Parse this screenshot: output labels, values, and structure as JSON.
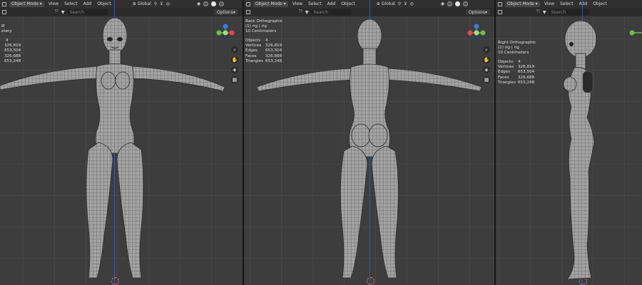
{
  "header": {
    "mode_label": "Object Mode",
    "menus": [
      "View",
      "Select",
      "Add",
      "Object"
    ],
    "orientation_label": "Global",
    "options_label": "Options",
    "search_placeholder": "Search"
  },
  "viewports": [
    {
      "view_name": "",
      "collection": "",
      "unit": "",
      "stats": [
        {
          "key": "",
          "value": "4"
        },
        {
          "key": "",
          "value": "326,819"
        },
        {
          "key": "",
          "value": "653,504"
        },
        {
          "key": "",
          "value": "326,688"
        },
        {
          "key": "",
          "value": "653,248"
        }
      ],
      "partial_lines": [
        "",
        "Ø",
        "etery"
      ]
    },
    {
      "view_name": "Back Orthographic",
      "collection": "(1) rig | rig",
      "unit": "10 Centimeters",
      "stats": [
        {
          "key": "Objects",
          "value": "4"
        },
        {
          "key": "Vertices",
          "value": "326,819"
        },
        {
          "key": "Edges",
          "value": "653,504"
        },
        {
          "key": "Faces",
          "value": "326,688"
        },
        {
          "key": "Triangles",
          "value": "653,248"
        }
      ]
    },
    {
      "view_name": "Right Orthographic",
      "collection": "(1) rig | rig",
      "unit": "10 Centimeters",
      "stats": [
        {
          "key": "Objects",
          "value": "4"
        },
        {
          "key": "Vertices",
          "value": "326,819"
        },
        {
          "key": "Edges",
          "value": "653,504"
        },
        {
          "key": "Faces",
          "value": "326,688"
        },
        {
          "key": "Triangles",
          "value": "653,248"
        }
      ]
    }
  ],
  "gizmo_axes": {
    "y": "Y",
    "x": "X",
    "z": "Z"
  },
  "icons": [
    "viewport-type-icon",
    "zoom-icon",
    "hand-icon",
    "camera-icon",
    "grid-icon"
  ],
  "colors": {
    "x_axis": "#e24a4a",
    "y_axis": "#6cc04a",
    "z_axis": "#3c7ad6",
    "grid": "#474747",
    "background": "#3d3d3d",
    "mesh": "#9b9b9b"
  }
}
